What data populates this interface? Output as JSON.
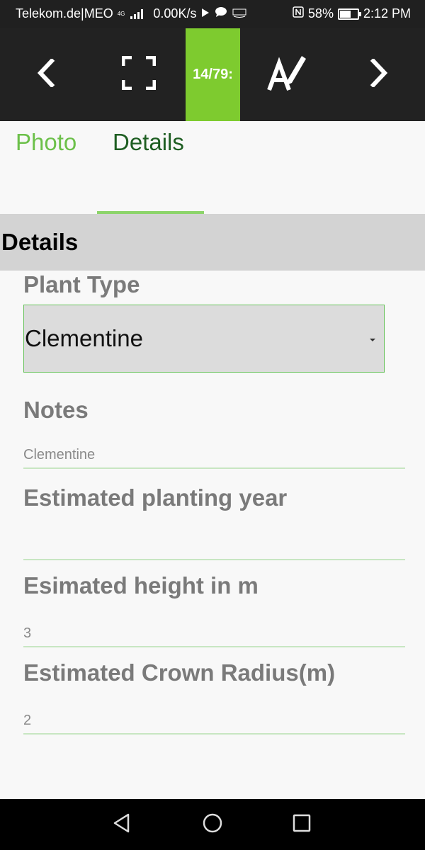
{
  "status_bar": {
    "carrier": "Telekom.de|MEO",
    "network_type": "4G",
    "speed": "0.00K/s",
    "battery": "58%",
    "time": "2:12 PM"
  },
  "toolbar": {
    "counter": "14/79:"
  },
  "tabs": [
    {
      "label": "Photo"
    },
    {
      "label": "Details"
    }
  ],
  "section": {
    "title": "Details"
  },
  "fields": {
    "plant_type": {
      "label": "Plant Type",
      "value": "Clementine"
    },
    "notes": {
      "label": "Notes",
      "value": "Clementine"
    },
    "planting_year": {
      "label": "Estimated planting year",
      "value": ""
    },
    "height": {
      "label": "Esimated height in m",
      "value": "3"
    },
    "crown_radius": {
      "label": "Estimated Crown Radius(m)",
      "value": "2"
    }
  },
  "icons": {
    "back": "chevron-left-icon",
    "fullscreen": "fullscreen-icon",
    "edit": "edit-text-icon",
    "next": "chevron-right-icon"
  },
  "colors": {
    "accent_green": "#7ecb2f",
    "tab_active": "#1e5e22",
    "tab_inactive": "#6cc04a",
    "toolbar_bg": "#222222"
  }
}
